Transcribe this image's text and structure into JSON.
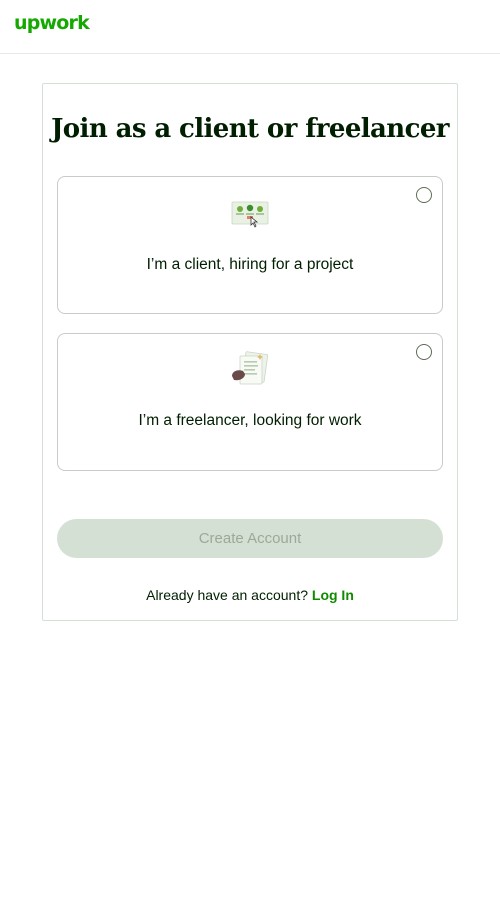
{
  "header": {
    "logo_text": "upwork",
    "brand_color": "#14a800"
  },
  "main": {
    "title": "Join as a client or freelancer",
    "options": [
      {
        "label": "I’m a client, hiring for a project",
        "icon": "client-hiring-illustration-icon",
        "selected": false
      },
      {
        "label": "I’m a freelancer, looking for work",
        "icon": "freelancer-documents-illustration-icon",
        "selected": false
      }
    ],
    "create_button_label": "Create Account",
    "create_button_enabled": false,
    "login_prompt": "Already have an account?",
    "login_link": "Log In"
  },
  "colors": {
    "text": "#001e00",
    "link": "#108a00",
    "button_disabled_bg": "#d5e0d5",
    "button_disabled_text": "#9aaa97",
    "border": "#c7ccc7"
  }
}
